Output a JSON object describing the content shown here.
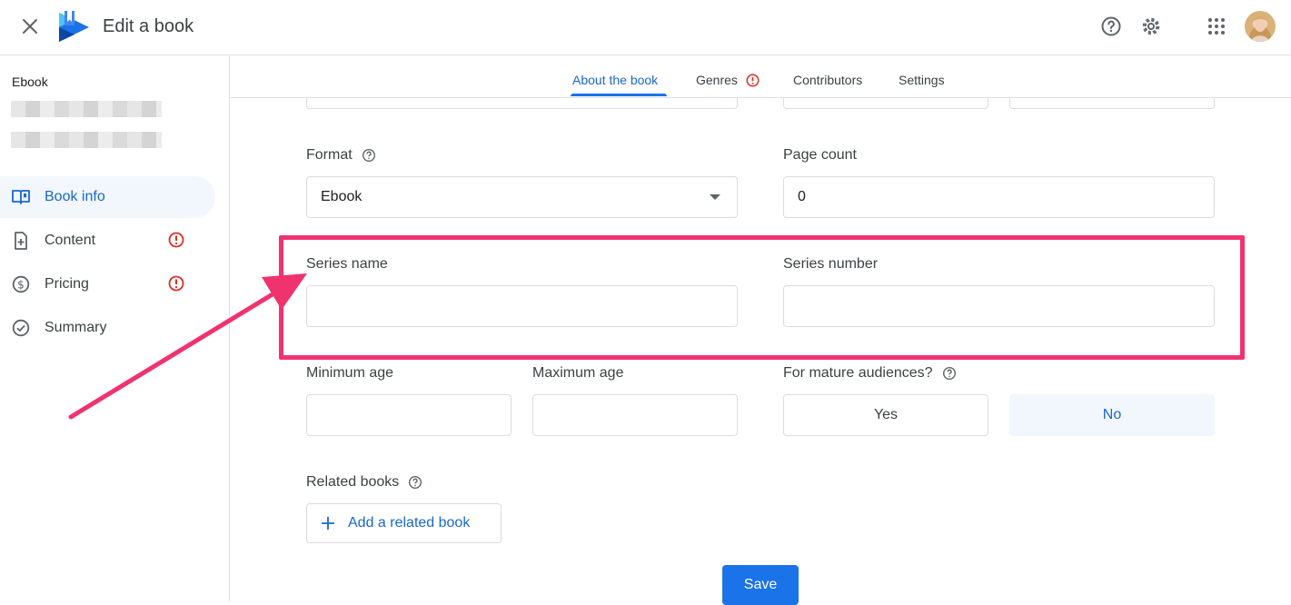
{
  "header": {
    "title": "Edit a book",
    "icons": [
      "close-icon",
      "play-books-logo",
      "help-icon",
      "settings-icon",
      "apps-grid-icon",
      "avatar"
    ]
  },
  "sidebar": {
    "book_type": "Ebook",
    "items": [
      {
        "label": "Book info",
        "icon": "book-open-icon",
        "active": true,
        "warning": false
      },
      {
        "label": "Content",
        "icon": "file-add-icon",
        "active": false,
        "warning": true
      },
      {
        "label": "Pricing",
        "icon": "dollar-circle-icon",
        "active": false,
        "warning": true
      },
      {
        "label": "Summary",
        "icon": "check-circle-icon",
        "active": false,
        "warning": false
      }
    ]
  },
  "tabs": [
    {
      "label": "About the book",
      "active": true
    },
    {
      "label": "Genres",
      "warning": true
    },
    {
      "label": "Contributors"
    },
    {
      "label": "Settings"
    }
  ],
  "form": {
    "format": {
      "label": "Format",
      "value": "Ebook"
    },
    "page_count": {
      "label": "Page count",
      "value": "0"
    },
    "series_name": {
      "label": "Series name",
      "value": ""
    },
    "series_number": {
      "label": "Series number",
      "value": ""
    },
    "min_age": {
      "label": "Minimum age",
      "value": ""
    },
    "max_age": {
      "label": "Maximum age",
      "value": ""
    },
    "mature": {
      "label": "For mature audiences?",
      "yes": "Yes",
      "no": "No",
      "selected": "No"
    },
    "related_books": {
      "label": "Related books",
      "add_button": "Add a related book"
    },
    "save": "Save"
  },
  "colors": {
    "accent": "#1a73e8",
    "highlight": "#f0336f",
    "warning": "#d93025"
  }
}
